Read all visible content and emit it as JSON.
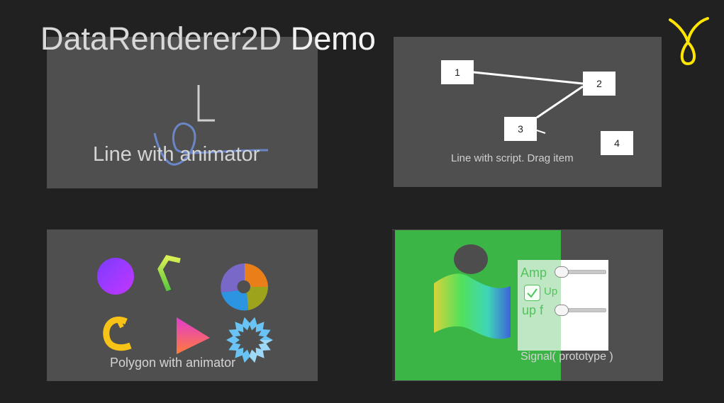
{
  "title": {
    "part1": "DataRenderer2D",
    "part2": "Demo"
  },
  "panels": {
    "line_animator": {
      "label": "Line with animator"
    },
    "line_script": {
      "label": "Line with script. Drag item",
      "nodes": [
        "1",
        "2",
        "3",
        "4"
      ]
    },
    "polygon_animator": {
      "label": "Polygon with animator"
    },
    "signal": {
      "label": "Signal( prototype )",
      "controls": {
        "amp_label": "Amp",
        "up_label": "Up",
        "up_checked": true,
        "upf_label": "up f",
        "amp_value": 0,
        "upf_value": 0
      }
    }
  },
  "icons": {
    "corner_logo": "yellow-loop-icon",
    "shapes": [
      "purple-circle",
      "green-arc",
      "color-wheel-ring",
      "yellow-c-shape",
      "pink-triangle",
      "blue-star-ring"
    ]
  },
  "colors": {
    "background": "#212121",
    "panel": "#4f4f4f",
    "signal_green": "#3cb547",
    "accent_yellow": "#ffe600",
    "line_blue": "#6a86c8"
  }
}
